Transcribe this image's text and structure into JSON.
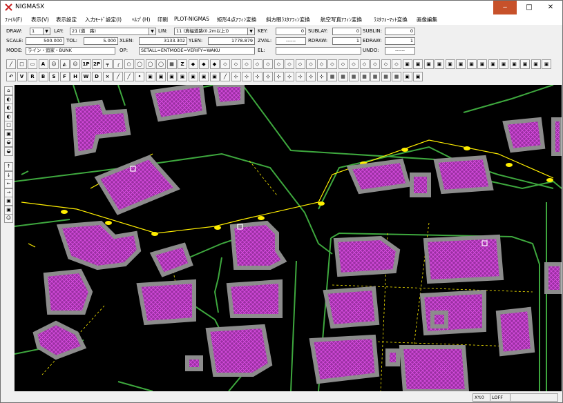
{
  "window": {
    "title": "NIGMASX",
    "min": "‒",
    "max": "□",
    "close": "✕"
  },
  "menu": [
    "ﾌｧｲﾙ(F)",
    "表示(V)",
    "表示設定",
    "入力ﾓｰﾄﾞ設定(I)",
    "ﾍﾙﾌﾟ(H)",
    "印刷",
    "PLOT-NIGMAS",
    "矩形4点ｱﾌｨﾝ変換",
    "斜方眼ﾗｽﾀｱﾌｨﾝ変換",
    "航空写真ｱﾌｨﾝ変換",
    "ﾗｽﾀﾌｫｰﾏｯﾄ変換",
    "画像編集"
  ],
  "fields": {
    "draw_label": "DRAW:",
    "draw_value": "1",
    "lay_label": "LAY:",
    "lay_value": "21 (道　路)",
    "lin_label": "LIN:",
    "lin_value": "11 (真幅道路(0.2m以上))",
    "key_label": "KEY:",
    "key_value": "0",
    "sublay_label": "SUBLAY:",
    "sublay_value": "0",
    "sublin_label": "SUBLIN:",
    "sublin_value": "0",
    "scale_label": "SCALE:",
    "scale_value": "500.000",
    "tol_label": "TOL:",
    "tol_value": "5.000",
    "xlen_label": "XLEN:",
    "xlen_value": "3133.302",
    "ylen_label": "YLEN:",
    "ylen_value": "1778.879",
    "zval_label": "ZVAL:",
    "zval_value": "------",
    "rdraw_label": "RDRAW:",
    "rdraw_value": "1",
    "edraw_label": "EDRAW:",
    "edraw_value": "1",
    "mode_label": "MODE:",
    "mode_value": "ライン・追家・BUNK",
    "op_label": "OP:",
    "op_value": "SETALL=ENTMODE=VERIFY=WAKU",
    "el_label": "EL:",
    "el_value": "",
    "undo_label": "UNDO:",
    "undo_value": "------"
  },
  "toolbar1": [
    "╱",
    "□",
    "▭",
    "A",
    "☺",
    "◭",
    "☺",
    "1P",
    "2P",
    "╤",
    "╭",
    "○",
    "◯",
    "◯",
    "◯",
    "▦",
    "Z",
    "◆",
    "◆",
    "◆",
    "◇",
    "◇",
    "◇",
    "◇",
    "◇",
    "◇",
    "◇",
    "◇",
    "◇",
    "◇",
    "◇",
    "◇",
    "◇",
    "◇",
    "◇",
    "◇",
    "◇",
    "▣",
    "▣",
    "▣",
    "▣",
    "▣",
    "▣",
    "▣",
    "▣",
    "▣",
    "▣",
    "▣",
    "▣",
    "▣",
    "▣"
  ],
  "toolbar2": [
    "↶",
    "V",
    "R",
    "B",
    "S",
    "F",
    "H",
    "W",
    "D",
    "×",
    "╱",
    "╱",
    "•",
    "▣",
    "▣",
    "▣",
    "▣",
    "▣",
    "▣",
    "▣",
    "╱",
    "⊹",
    "⊹",
    "⊹",
    "⊹",
    "⊹",
    "⊹",
    "⊹",
    "⊹",
    "⊹",
    "▦",
    "▦",
    "▦",
    "▦",
    "▦",
    "▦",
    "▦",
    "▣",
    "▣"
  ],
  "sidebar": [
    "⌂",
    "◐",
    "◐",
    "◐",
    "□",
    "▣",
    "◒",
    "◒",
    "↑",
    "↓",
    "←",
    "→",
    "▣",
    "▣",
    "☺"
  ],
  "status": {
    "xy": "XY:0",
    "mode": "LOFF",
    "extra": ""
  },
  "colors": {
    "map_bg": "#000000",
    "building_fill": "#9a2fa2",
    "building_hatch": "#d040d8",
    "shadow": "#8c8c8c",
    "boundary": "#3ea83e",
    "road_line": "#ffee00",
    "marker": "#ffee00"
  }
}
